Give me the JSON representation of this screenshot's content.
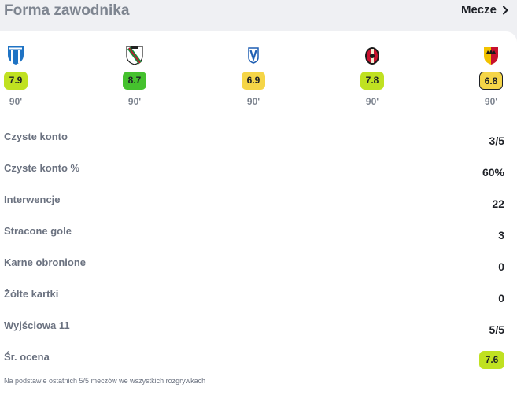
{
  "header": {
    "title": "Forma zawodnika",
    "more_label": "Mecze",
    "more_icon": "chevron-right-icon"
  },
  "matches": [
    {
      "crest": "team-crest-blue-white",
      "rating": "7.9",
      "minutes": "90'",
      "color": "#c0e121",
      "outlined": false
    },
    {
      "crest": "team-crest-legia",
      "rating": "8.7",
      "minutes": "90'",
      "color": "#45c12e",
      "outlined": false
    },
    {
      "crest": "team-crest-lech",
      "rating": "6.9",
      "minutes": "90'",
      "color": "#f5d547",
      "outlined": false
    },
    {
      "crest": "team-crest-red-black",
      "rating": "7.8",
      "minutes": "90'",
      "color": "#c0e121",
      "outlined": false
    },
    {
      "crest": "team-crest-korona",
      "rating": "6.8",
      "minutes": "90'",
      "color": "#f5d547",
      "outlined": true
    }
  ],
  "stats": [
    {
      "label": "Czyste konto",
      "value": "3/5"
    },
    {
      "label": "Czyste konto %",
      "value": "60%"
    },
    {
      "label": "Interwencje",
      "value": "22"
    },
    {
      "label": "Stracone gole",
      "value": "3"
    },
    {
      "label": "Karne obronione",
      "value": "0"
    },
    {
      "label": "Żółte kartki",
      "value": "0"
    },
    {
      "label": "Wyjściowa 11",
      "value": "5/5"
    },
    {
      "label": "Śr. ocena",
      "value": "7.6",
      "badge_color": "#c0e121"
    }
  ],
  "footnote": "Na podstawie ostatnich 5/5 meczów we wszystkich rozgrywkach"
}
